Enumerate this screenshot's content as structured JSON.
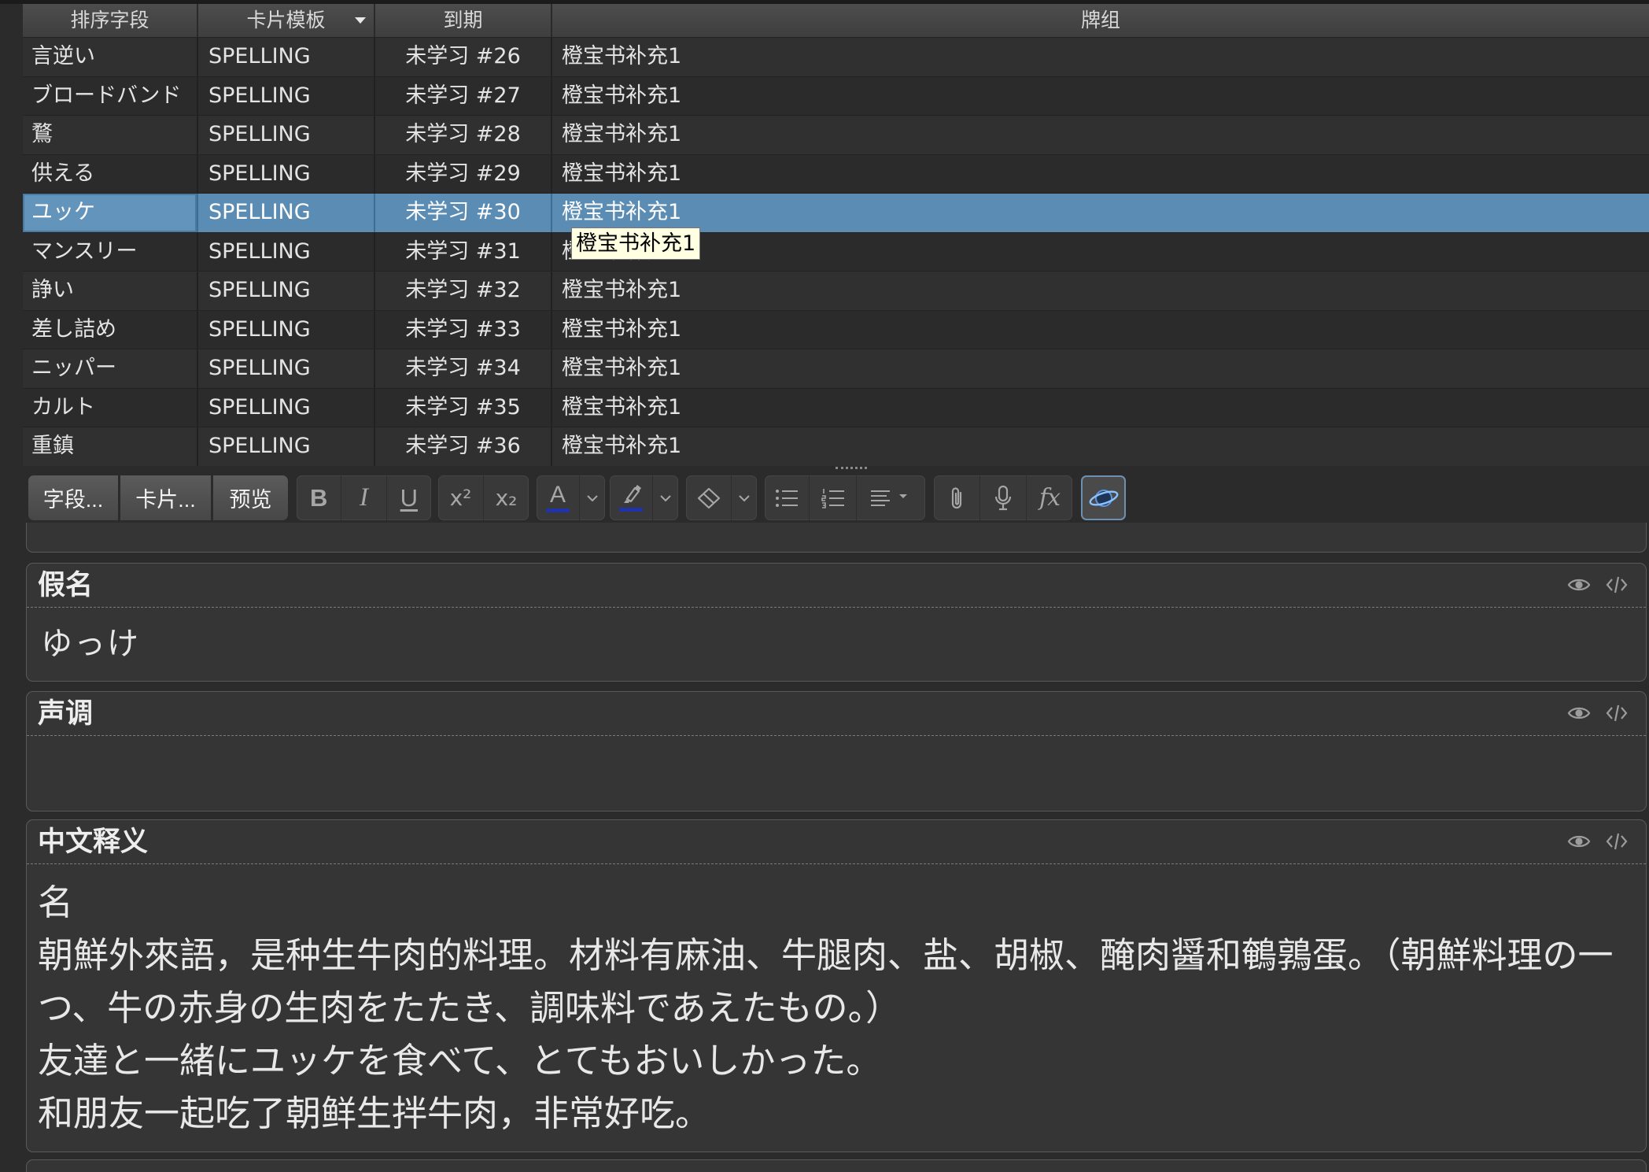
{
  "table": {
    "columns": [
      "排序字段",
      "卡片模板",
      "到期",
      "牌组"
    ],
    "selected_row": 4,
    "rows": [
      {
        "sort_field": "言逆い",
        "card_template": "SPELLING",
        "due": "未学习 #26",
        "deck": "橙宝书补充1"
      },
      {
        "sort_field": "ブロードバンド",
        "card_template": "SPELLING",
        "due": "未学习 #27",
        "deck": "橙宝书补充1"
      },
      {
        "sort_field": "鶩",
        "card_template": "SPELLING",
        "due": "未学习 #28",
        "deck": "橙宝书补充1"
      },
      {
        "sort_field": "供える",
        "card_template": "SPELLING",
        "due": "未学习 #29",
        "deck": "橙宝书补充1"
      },
      {
        "sort_field": "ユッケ",
        "card_template": "SPELLING",
        "due": "未学习 #30",
        "deck": "橙宝书补充1"
      },
      {
        "sort_field": "マンスリー",
        "card_template": "SPELLING",
        "due": "未学习 #31",
        "deck": "橙宝书补充1"
      },
      {
        "sort_field": "諍い",
        "card_template": "SPELLING",
        "due": "未学习 #32",
        "deck": "橙宝书补充1"
      },
      {
        "sort_field": "差し詰め",
        "card_template": "SPELLING",
        "due": "未学习 #33",
        "deck": "橙宝书补充1"
      },
      {
        "sort_field": "ニッパー",
        "card_template": "SPELLING",
        "due": "未学习 #34",
        "deck": "橙宝书补充1"
      },
      {
        "sort_field": "カルト",
        "card_template": "SPELLING",
        "due": "未学习 #35",
        "deck": "橙宝书补充1"
      },
      {
        "sort_field": "重鎮",
        "card_template": "SPELLING",
        "due": "未学习 #36",
        "deck": "橙宝书补充1"
      }
    ]
  },
  "tooltip": {
    "text": "橙宝书补充1"
  },
  "toolbar": {
    "fields_button": "字段...",
    "cards_button": "卡片...",
    "preview_button": "预览",
    "bold_glyph": "B",
    "italic_glyph": "I",
    "underline_glyph": "U",
    "superscript_glyph": "x²",
    "subscript_glyph": "x₂",
    "text_color_glyph": "A",
    "math_glyph": "fx",
    "icons": [
      "bold-icon",
      "italic-icon",
      "underline-icon",
      "superscript-icon",
      "subscript-icon",
      "text-color-icon",
      "highlighter-icon",
      "eraser-icon",
      "bullet-list-icon",
      "numbered-list-icon",
      "align-icon",
      "paperclip-icon",
      "microphone-icon",
      "math-fx-icon",
      "addon-orbit-icon",
      "chevron-down-icon"
    ]
  },
  "editor": {
    "field_icons": [
      "eye-icon",
      "code-icon"
    ],
    "fields": [
      {
        "label": "假名",
        "lines": [
          "ゆっけ"
        ]
      },
      {
        "label": "声调",
        "lines": []
      },
      {
        "label": "中文释义",
        "lines": [
          "名",
          "朝鮮外來語，是种生牛肉的料理。材料有麻油、牛腿肉、盐、胡椒、醃肉醤和鵪鶉蛋。（朝鮮料理の一つ、牛の赤身の生肉をたたき、調味料であえたもの。）",
          "友達と一緒にユッケを食べて、とてもおいしかった。",
          "和朋友一起吃了朝鲜生拌牛肉，非常好吃。"
        ]
      }
    ]
  },
  "colors": {
    "selected_row": "#5b8cb3",
    "text_color_bar": "#2233aa",
    "highlight_bar": "#2233aa",
    "tooltip_background": "#ffffe1"
  }
}
